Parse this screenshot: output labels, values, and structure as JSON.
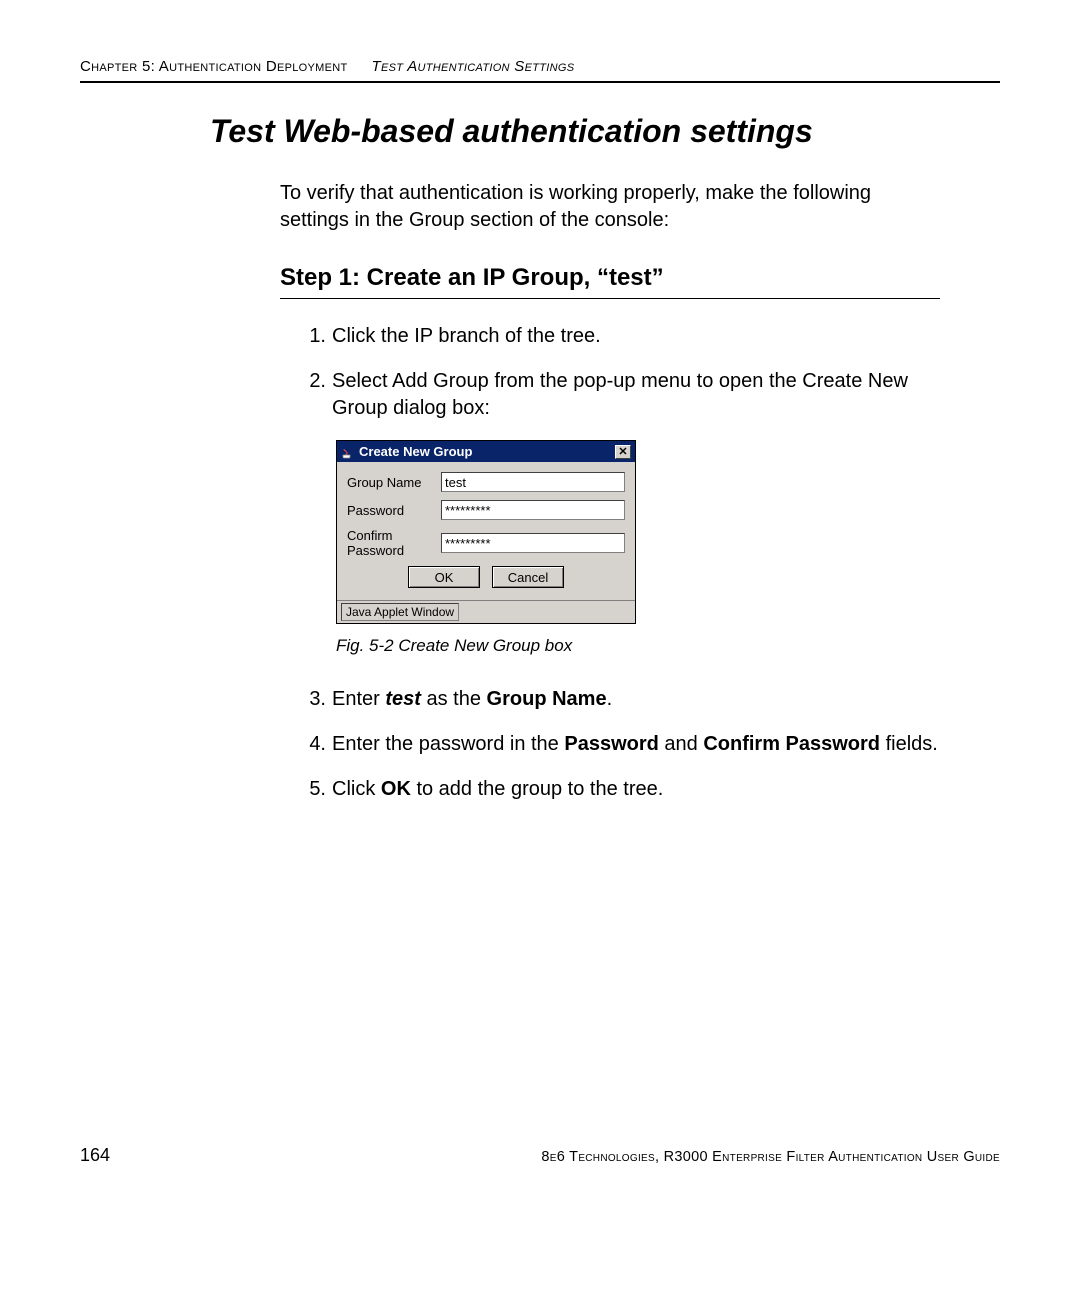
{
  "header": {
    "left": "Chapter 5: Authentication Deployment",
    "right": "Test Authentication Settings"
  },
  "h1": "Test Web-based authentication settings",
  "intro": "To verify that authentication is working properly, make the following settings in the Group section of the console:",
  "h2": "Step 1: Create an IP Group, “test”",
  "list1": {
    "n1": "1.",
    "t1": "Click the IP branch of the tree.",
    "n2": "2.",
    "t2": "Select Add Group from the pop-up menu to open the Create New Group dialog box:"
  },
  "dialog": {
    "title": "Create New Group",
    "close": "✕",
    "labels": {
      "group": "Group Name",
      "pass": "Password",
      "confirm": "Confirm Password"
    },
    "values": {
      "group": "test",
      "pass": "*********",
      "confirm": "*********"
    },
    "buttons": {
      "ok": "OK",
      "cancel": "Cancel"
    },
    "status": "Java Applet Window"
  },
  "figcaption": "Fig. 5-2  Create New Group box",
  "list2": {
    "n3": "3.",
    "t3a": "Enter ",
    "t3b": "test",
    "t3c": " as the ",
    "t3d": "Group Name",
    "t3e": ".",
    "n4": "4.",
    "t4a": "Enter the password in the ",
    "t4b": "Password",
    "t4c": " and ",
    "t4d": "Confirm Pass­word",
    "t4e": " fields.",
    "n5": "5.",
    "t5a": "Click ",
    "t5b": "OK",
    "t5c": " to add the group to the tree."
  },
  "footer": {
    "page": "164",
    "text": "8e6 Technologies, R3000 Enterprise Filter Authentication User Guide"
  }
}
